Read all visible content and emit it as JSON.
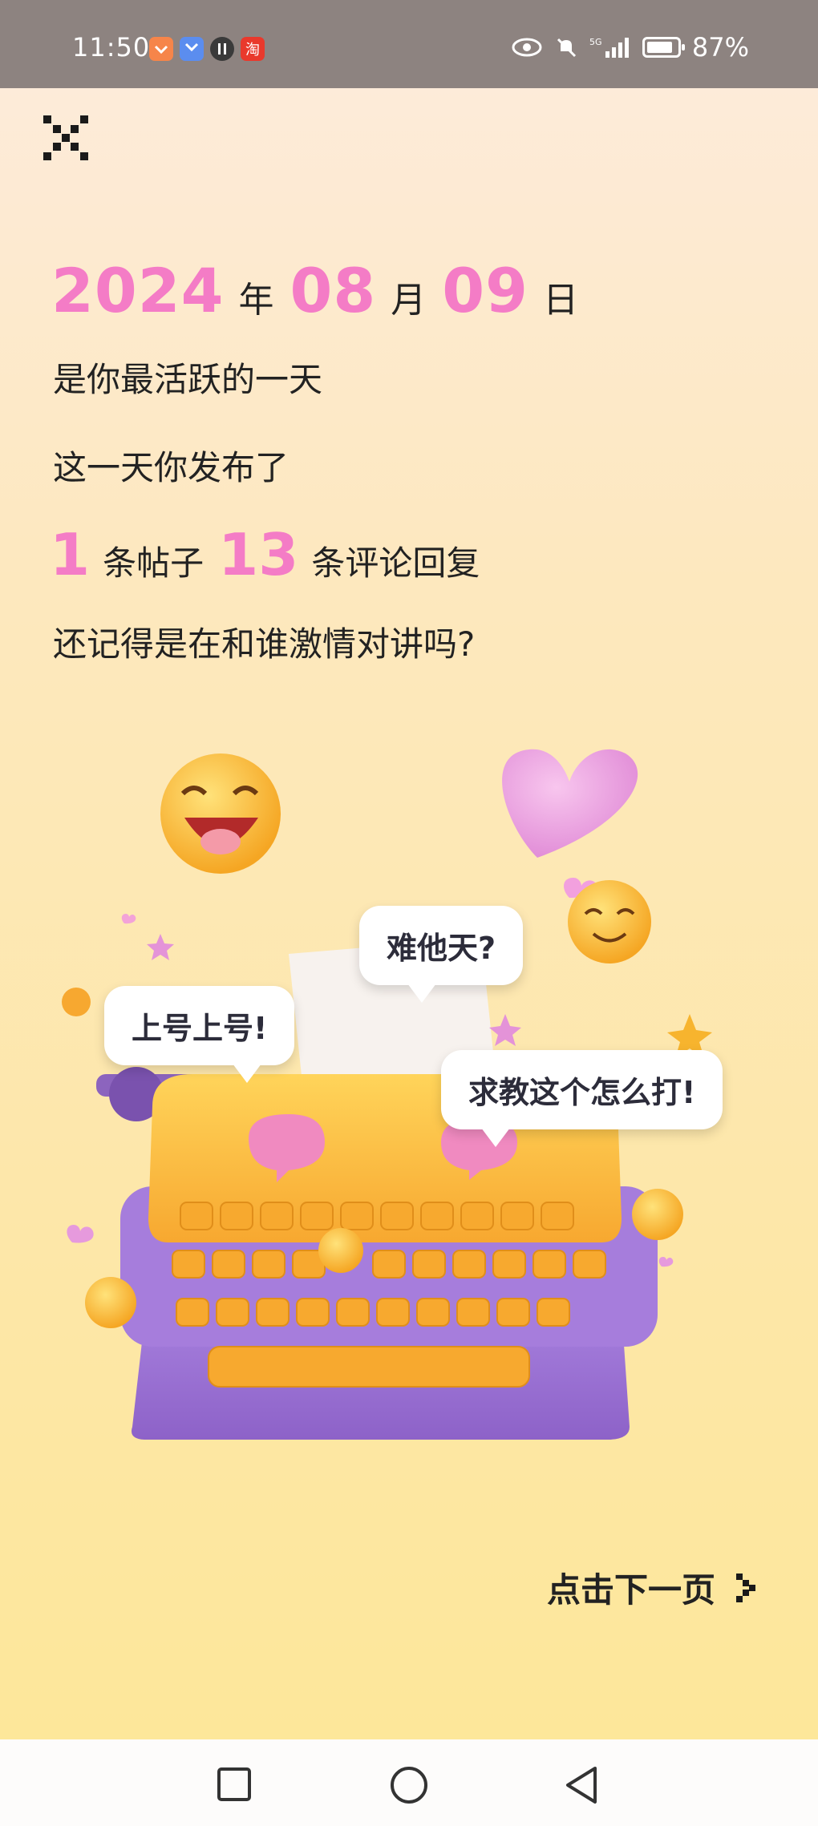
{
  "status_bar": {
    "time": "11:50",
    "battery_text": "87%",
    "battery_level": 0.87,
    "network": "5G",
    "icons": [
      "app-icon-orange",
      "app-icon-blue",
      "pause-app-icon",
      "taobao-icon",
      "eye-icon",
      "mute-icon",
      "signal-icon",
      "battery-icon"
    ]
  },
  "header": {
    "close_icon": "close-icon"
  },
  "summary": {
    "year": "2024",
    "year_unit": "年",
    "month": "08",
    "month_unit": "月",
    "day": "09",
    "day_unit": "日",
    "line1": "是你最活跃的一天",
    "line2": "这一天你发布了",
    "post_count": "1",
    "post_unit": "条帖子",
    "comment_count": "13",
    "comment_unit": "条评论回复",
    "line4": "还记得是在和谁激情对讲吗?"
  },
  "illustration": {
    "bubbles": [
      "上号上号!",
      "难他天?",
      "求教这个怎么打!"
    ]
  },
  "footer": {
    "next_label": "点击下一页",
    "next_icon": "pixel-arrow-right-icon"
  },
  "nav": {
    "icons": [
      "recent-apps-icon",
      "home-icon",
      "back-icon"
    ]
  },
  "colors": {
    "accent_pink": "#f47cc6",
    "status_bar": "#8d8380",
    "text": "#222222"
  }
}
